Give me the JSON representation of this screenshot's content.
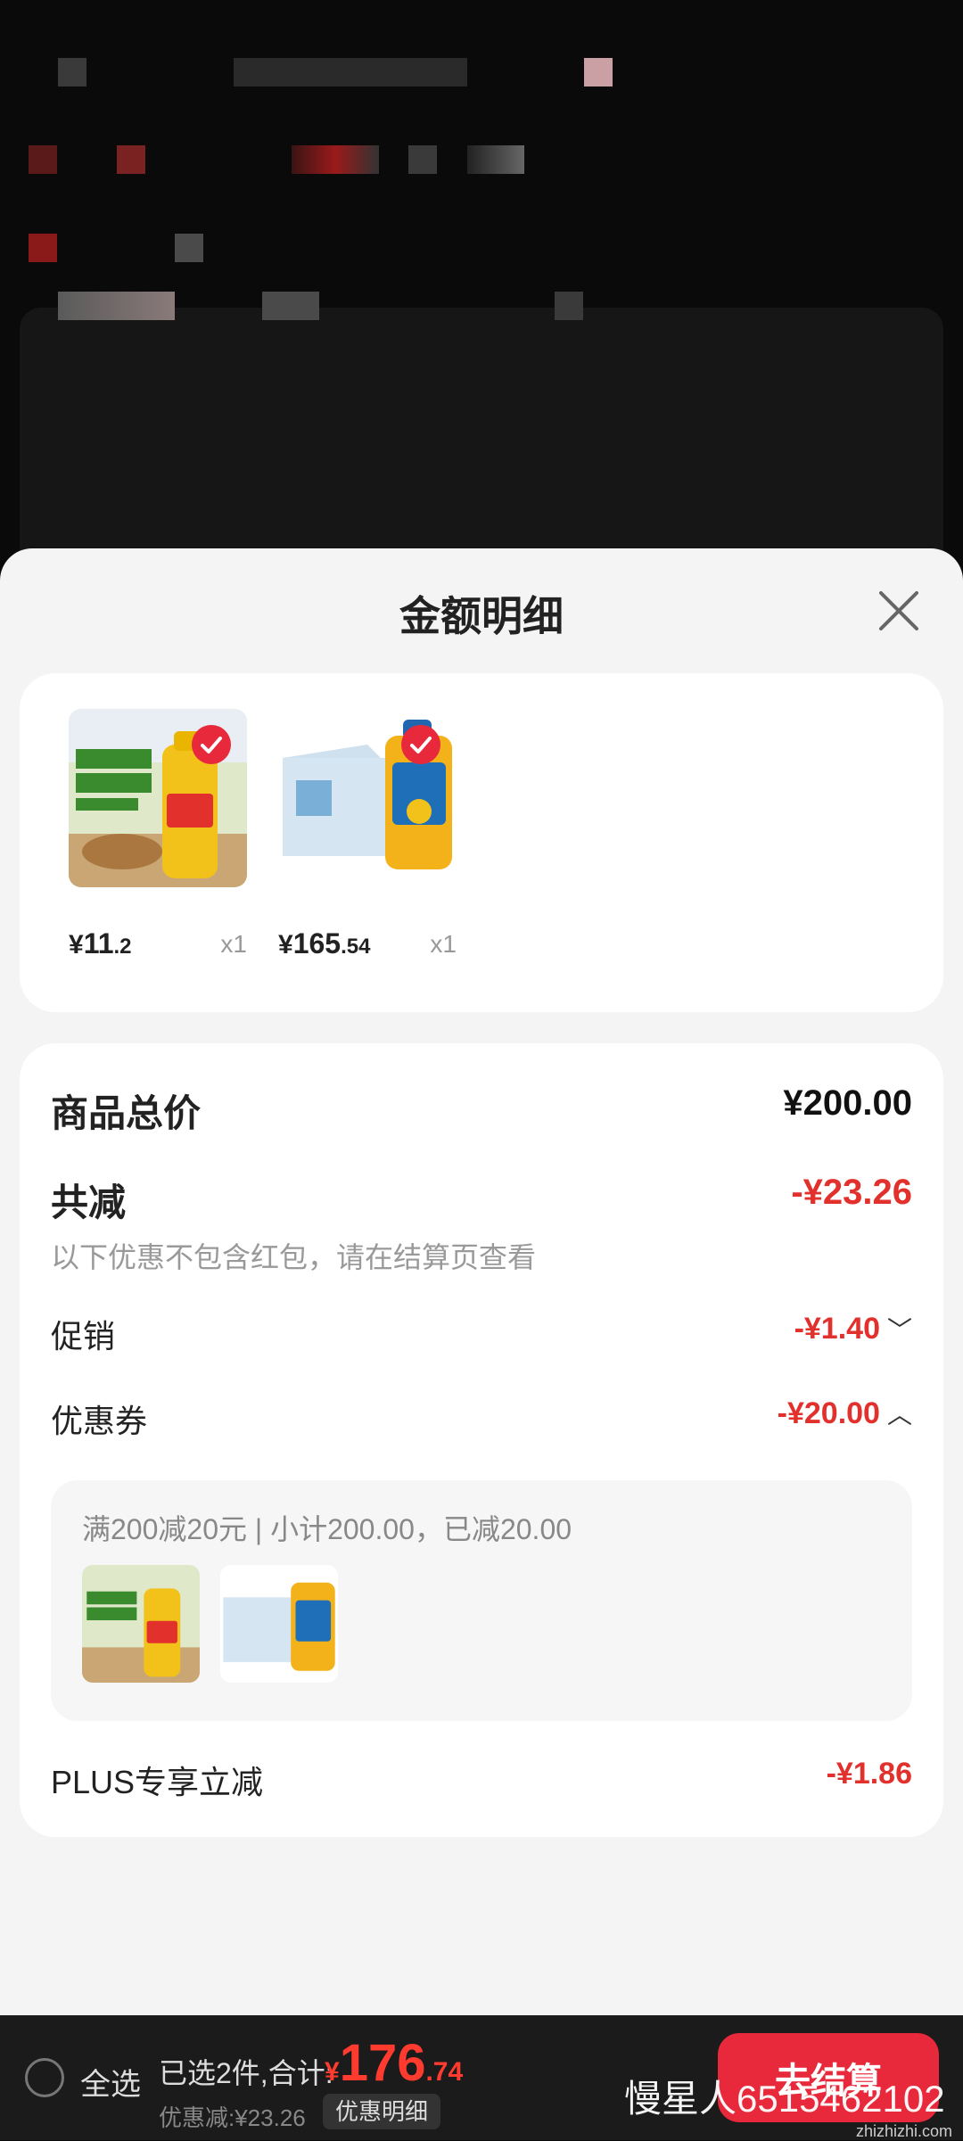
{
  "sheet": {
    "title": "金额明细"
  },
  "products": [
    {
      "price_symbol": "¥",
      "price_int": "11",
      "price_dec": ".2",
      "qty": "x1"
    },
    {
      "price_symbol": "¥",
      "price_int": "165",
      "price_dec": ".54",
      "qty": "x1"
    }
  ],
  "product_images": [
    {
      "texts": [
        "非转基因",
        "一级大豆油",
        "700ml/桶",
        "金龙鱼"
      ]
    },
    {
      "texts": [
        "福"
      ]
    }
  ],
  "summary": {
    "total_label": "商品总价",
    "total_value": "¥200.00",
    "reduce_label": "共减",
    "reduce_value": "-¥23.26",
    "reduce_note": "以下优惠不包含红包，请在结算页查看",
    "promo_label": "促销",
    "promo_value": "-¥1.40",
    "promo_chevron": "﹀",
    "coupon_label": "优惠券",
    "coupon_value": "-¥20.00",
    "coupon_chevron": "︿",
    "coupon_detail": "满200减20元 | 小计200.00，已减20.00",
    "plus_label": "PLUS专享立减",
    "plus_value": "-¥1.86"
  },
  "bottom_bar": {
    "select_all": "全选",
    "picked": "已选2件,合计:",
    "total_symbol": "¥",
    "total_int": "176",
    "total_dec": ".74",
    "saved": "优惠减:¥23.26",
    "detail_button": "优惠明细",
    "checkout": "去结算",
    "watermark": "慢星人6515462102",
    "watermark_site": "zhizhizhi.com"
  },
  "colors": {
    "accent": "#e8293b",
    "discount": "#e2302d",
    "sheet_bg": "#f4f4f4"
  }
}
